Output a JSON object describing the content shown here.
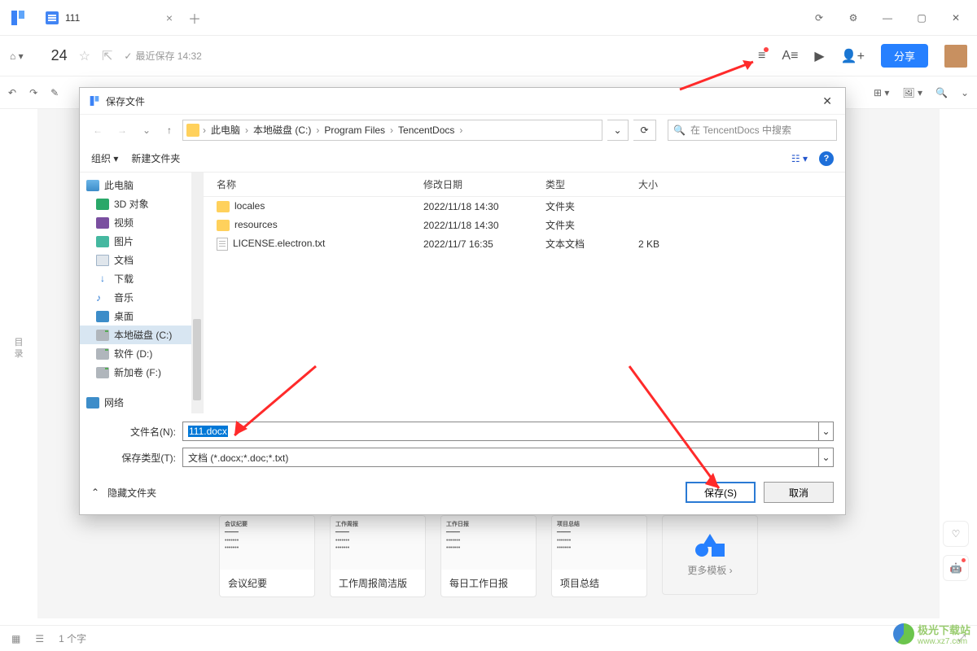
{
  "titlebar": {
    "tab_title": "111"
  },
  "toolbar": {
    "page_number": "24",
    "save_status": "最近保存 14:32",
    "share_label": "分享"
  },
  "leftrail": {
    "label1": "目",
    "label2": "录"
  },
  "dialog": {
    "title": "保存文件",
    "breadcrumb": [
      "此电脑",
      "本地磁盘 (C:)",
      "Program Files",
      "TencentDocs"
    ],
    "search_placeholder": "在 TencentDocs 中搜索",
    "organize": "组织",
    "new_folder": "新建文件夹",
    "columns": {
      "name": "名称",
      "date": "修改日期",
      "type": "类型",
      "size": "大小"
    },
    "tree": [
      {
        "icon": "ico-pc",
        "label": "此电脑",
        "top": true
      },
      {
        "icon": "ico-3d",
        "label": "3D 对象"
      },
      {
        "icon": "ico-vid",
        "label": "视频"
      },
      {
        "icon": "ico-pic",
        "label": "图片"
      },
      {
        "icon": "ico-doc",
        "label": "文档"
      },
      {
        "icon": "ico-dl",
        "label": "下载",
        "glyph": "↓"
      },
      {
        "icon": "ico-mus",
        "label": "音乐",
        "glyph": "♪"
      },
      {
        "icon": "ico-desk",
        "label": "桌面"
      },
      {
        "icon": "ico-drv",
        "label": "本地磁盘 (C:)",
        "selected": true
      },
      {
        "icon": "ico-drv",
        "label": "软件 (D:)"
      },
      {
        "icon": "ico-drv",
        "label": "新加卷 (F:)"
      },
      {
        "icon": "ico-net",
        "label": "网络",
        "top": true,
        "gap": true
      }
    ],
    "files": [
      {
        "kind": "folder",
        "name": "locales",
        "date": "2022/11/18 14:30",
        "type": "文件夹",
        "size": ""
      },
      {
        "kind": "folder",
        "name": "resources",
        "date": "2022/11/18 14:30",
        "type": "文件夹",
        "size": ""
      },
      {
        "kind": "txt",
        "name": "LICENSE.electron.txt",
        "date": "2022/11/7 16:35",
        "type": "文本文档",
        "size": "2 KB"
      }
    ],
    "filename_label": "文件名(N):",
    "filename_value": "111.docx",
    "type_label": "保存类型(T):",
    "type_value": "文档 (*.docx;*.doc;*.txt)",
    "hide_folders": "隐藏文件夹",
    "save_btn": "保存(S)",
    "cancel_btn": "取消"
  },
  "templates": {
    "items": [
      "会议纪要",
      "工作周报简洁版",
      "每日工作日报",
      "项目总结"
    ],
    "more": "更多模板",
    "previews": {
      "0": "会议纪要",
      "1": "工作周报",
      "2": "工作日报",
      "3": "项目总结"
    }
  },
  "statusbar": {
    "words": "1 个字"
  },
  "watermark": {
    "text": "极光下载站",
    "url": "www.xz7.com"
  }
}
